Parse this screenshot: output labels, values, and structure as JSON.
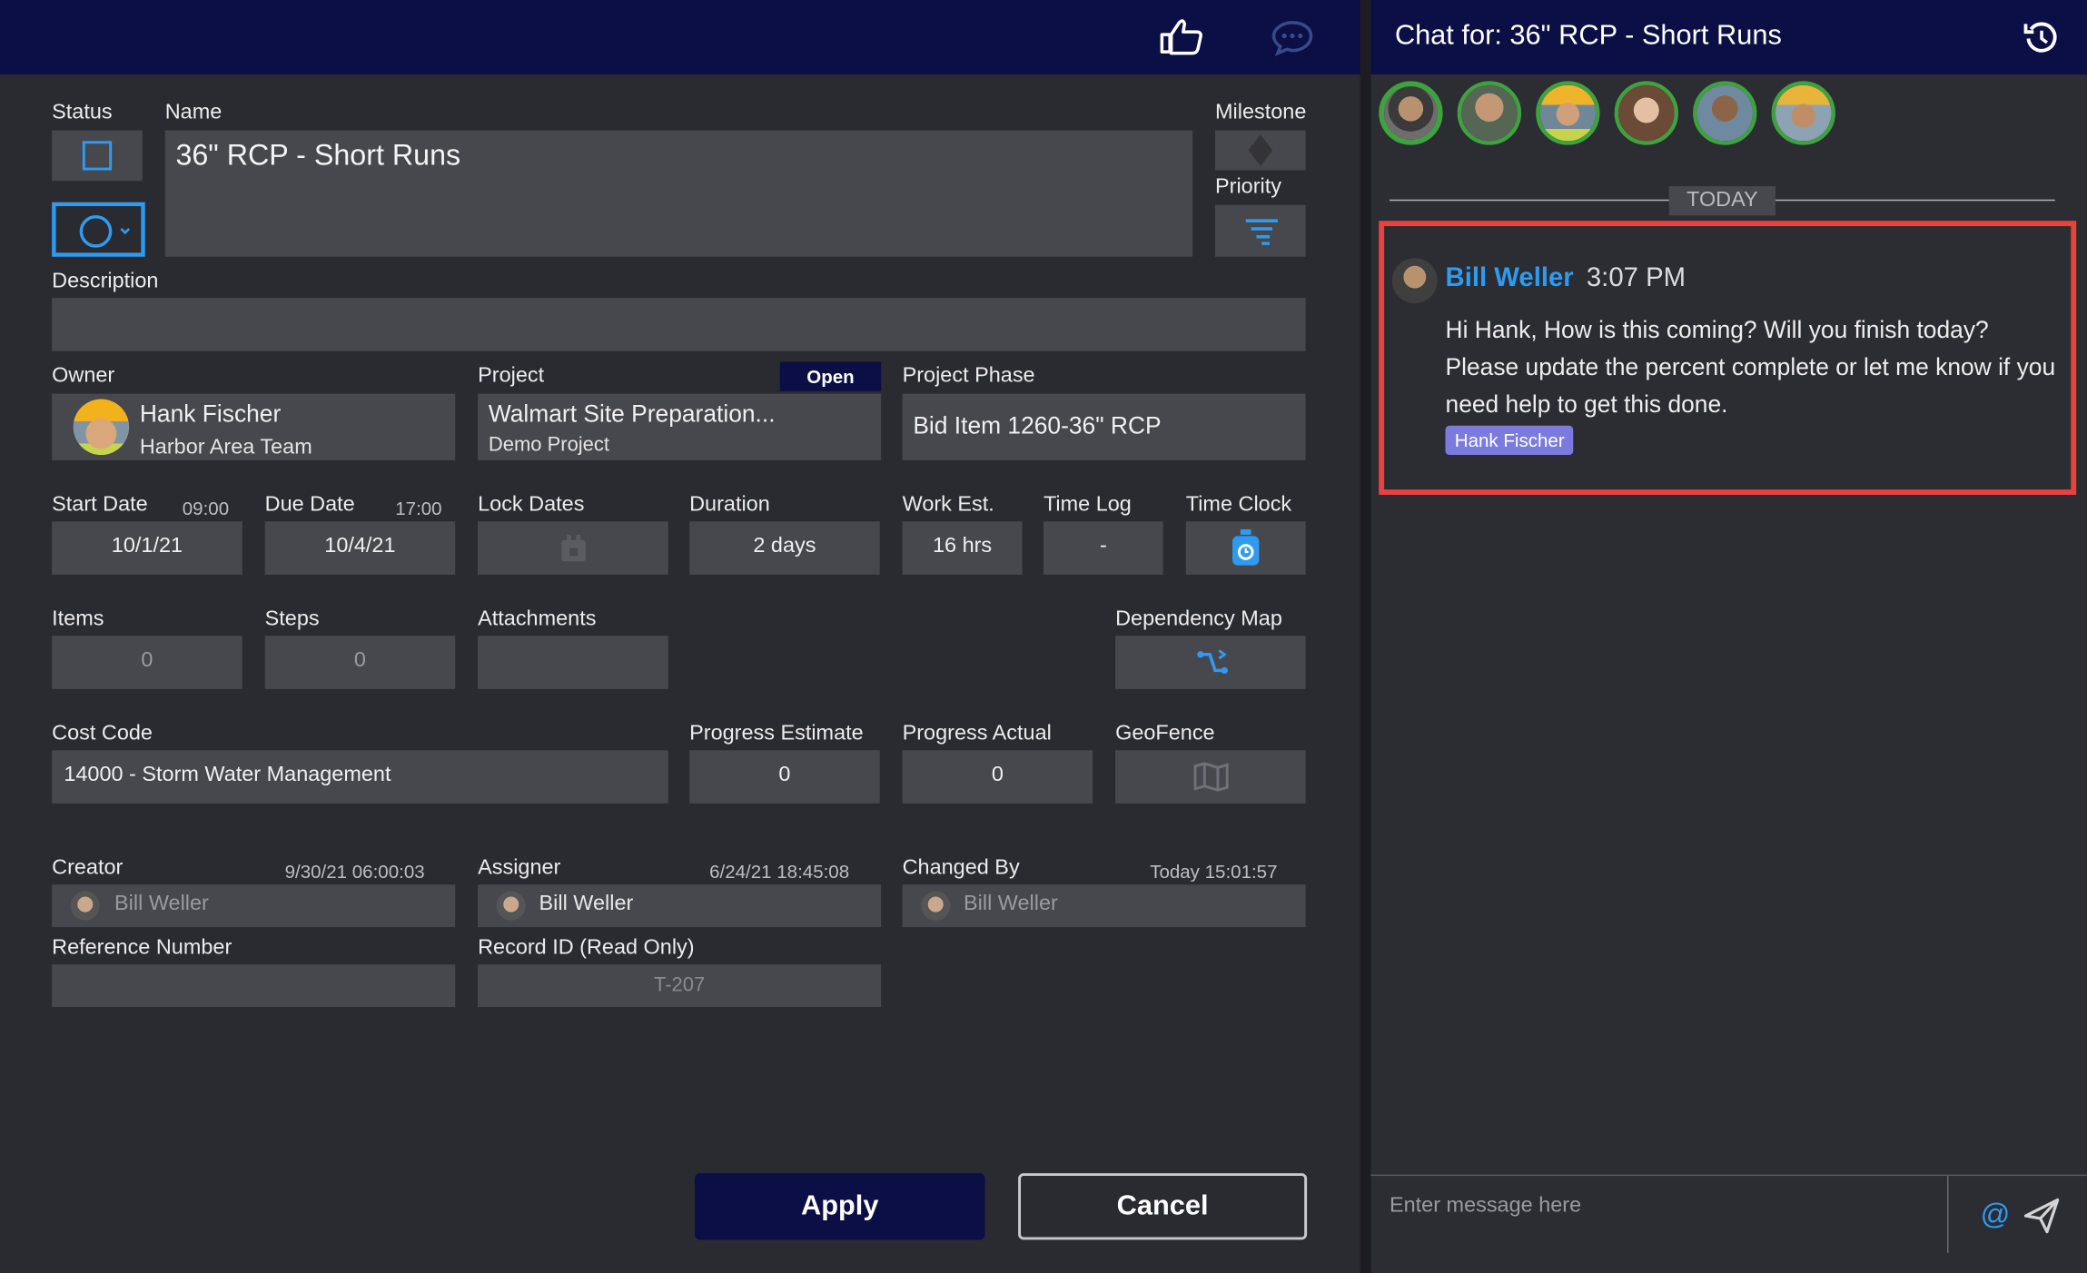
{
  "task_form": {
    "status_label": "Status",
    "name_label": "Name",
    "name_value": "36\" RCP - Short Runs",
    "milestone_label": "Milestone",
    "priority_label": "Priority",
    "description_label": "Description",
    "description_value": "",
    "owner_label": "Owner",
    "owner_name": "Hank Fischer",
    "owner_team": "Harbor Area Team",
    "project_label": "Project",
    "project_status_badge": "Open",
    "project_name": "Walmart Site Preparation...",
    "project_sub": "Demo Project",
    "phase_label": "Project Phase",
    "phase_value": "Bid Item 1260-36\" RCP",
    "start_label": "Start Date",
    "start_time": "09:00",
    "start_value": "10/1/21",
    "due_label": "Due Date",
    "due_time": "17:00",
    "due_value": "10/4/21",
    "lock_label": "Lock Dates",
    "duration_label": "Duration",
    "duration_value": "2 days",
    "work_label": "Work Est.",
    "work_value": "16 hrs",
    "timelog_label": "Time Log",
    "timelog_value": "-",
    "timeclock_label": "Time Clock",
    "items_label": "Items",
    "items_value": "0",
    "steps_label": "Steps",
    "steps_value": "0",
    "attachments_label": "Attachments",
    "depmap_label": "Dependency Map",
    "costcode_label": "Cost Code",
    "costcode_value": "14000 - Storm Water Management",
    "progest_label": "Progress Estimate",
    "progest_value": "0",
    "progact_label": "Progress Actual",
    "progact_value": "0",
    "geofence_label": "GeoFence",
    "creator_label": "Creator",
    "creator_date": "9/30/21  06:00:03",
    "creator_name": "Bill Weller",
    "assigner_label": "Assigner",
    "assigner_date": "6/24/21  18:45:08",
    "assigner_name": "Bill Weller",
    "changed_label": "Changed By",
    "changed_date": "Today  15:01:57",
    "changed_name": "Bill Weller",
    "refnum_label": "Reference Number",
    "refnum_value": "",
    "recordid_label": "Record ID (Read Only)",
    "recordid_value": "T-207",
    "apply_label": "Apply",
    "cancel_label": "Cancel"
  },
  "chat": {
    "title": "Chat for: 36\" RCP - Short Runs",
    "day_separator": "TODAY",
    "message": {
      "author": "Bill Weller",
      "time": "3:07 PM",
      "text": "Hi Hank, How is this coming? Will you finish today? Please update the percent complete or let me know if you need help to get this done.",
      "mention_tag": "Hank Fischer"
    },
    "input_placeholder": "Enter message here",
    "at_symbol": "@"
  },
  "colors": {
    "header_navy": "#0b0f45",
    "accent_blue": "#2f9bf0",
    "highlight_red": "#e8443f",
    "avatar_green": "#3ea33e",
    "mention_purple": "#7b7bdf"
  },
  "icons": [
    "thumbs-up-icon",
    "comment-icon",
    "history-icon",
    "checkbox-icon",
    "circle-status-icon",
    "milestone-diamond-icon",
    "priority-filter-icon",
    "calendar-lock-icon",
    "stopwatch-icon",
    "dependency-icon",
    "map-icon",
    "at-icon",
    "send-icon"
  ]
}
